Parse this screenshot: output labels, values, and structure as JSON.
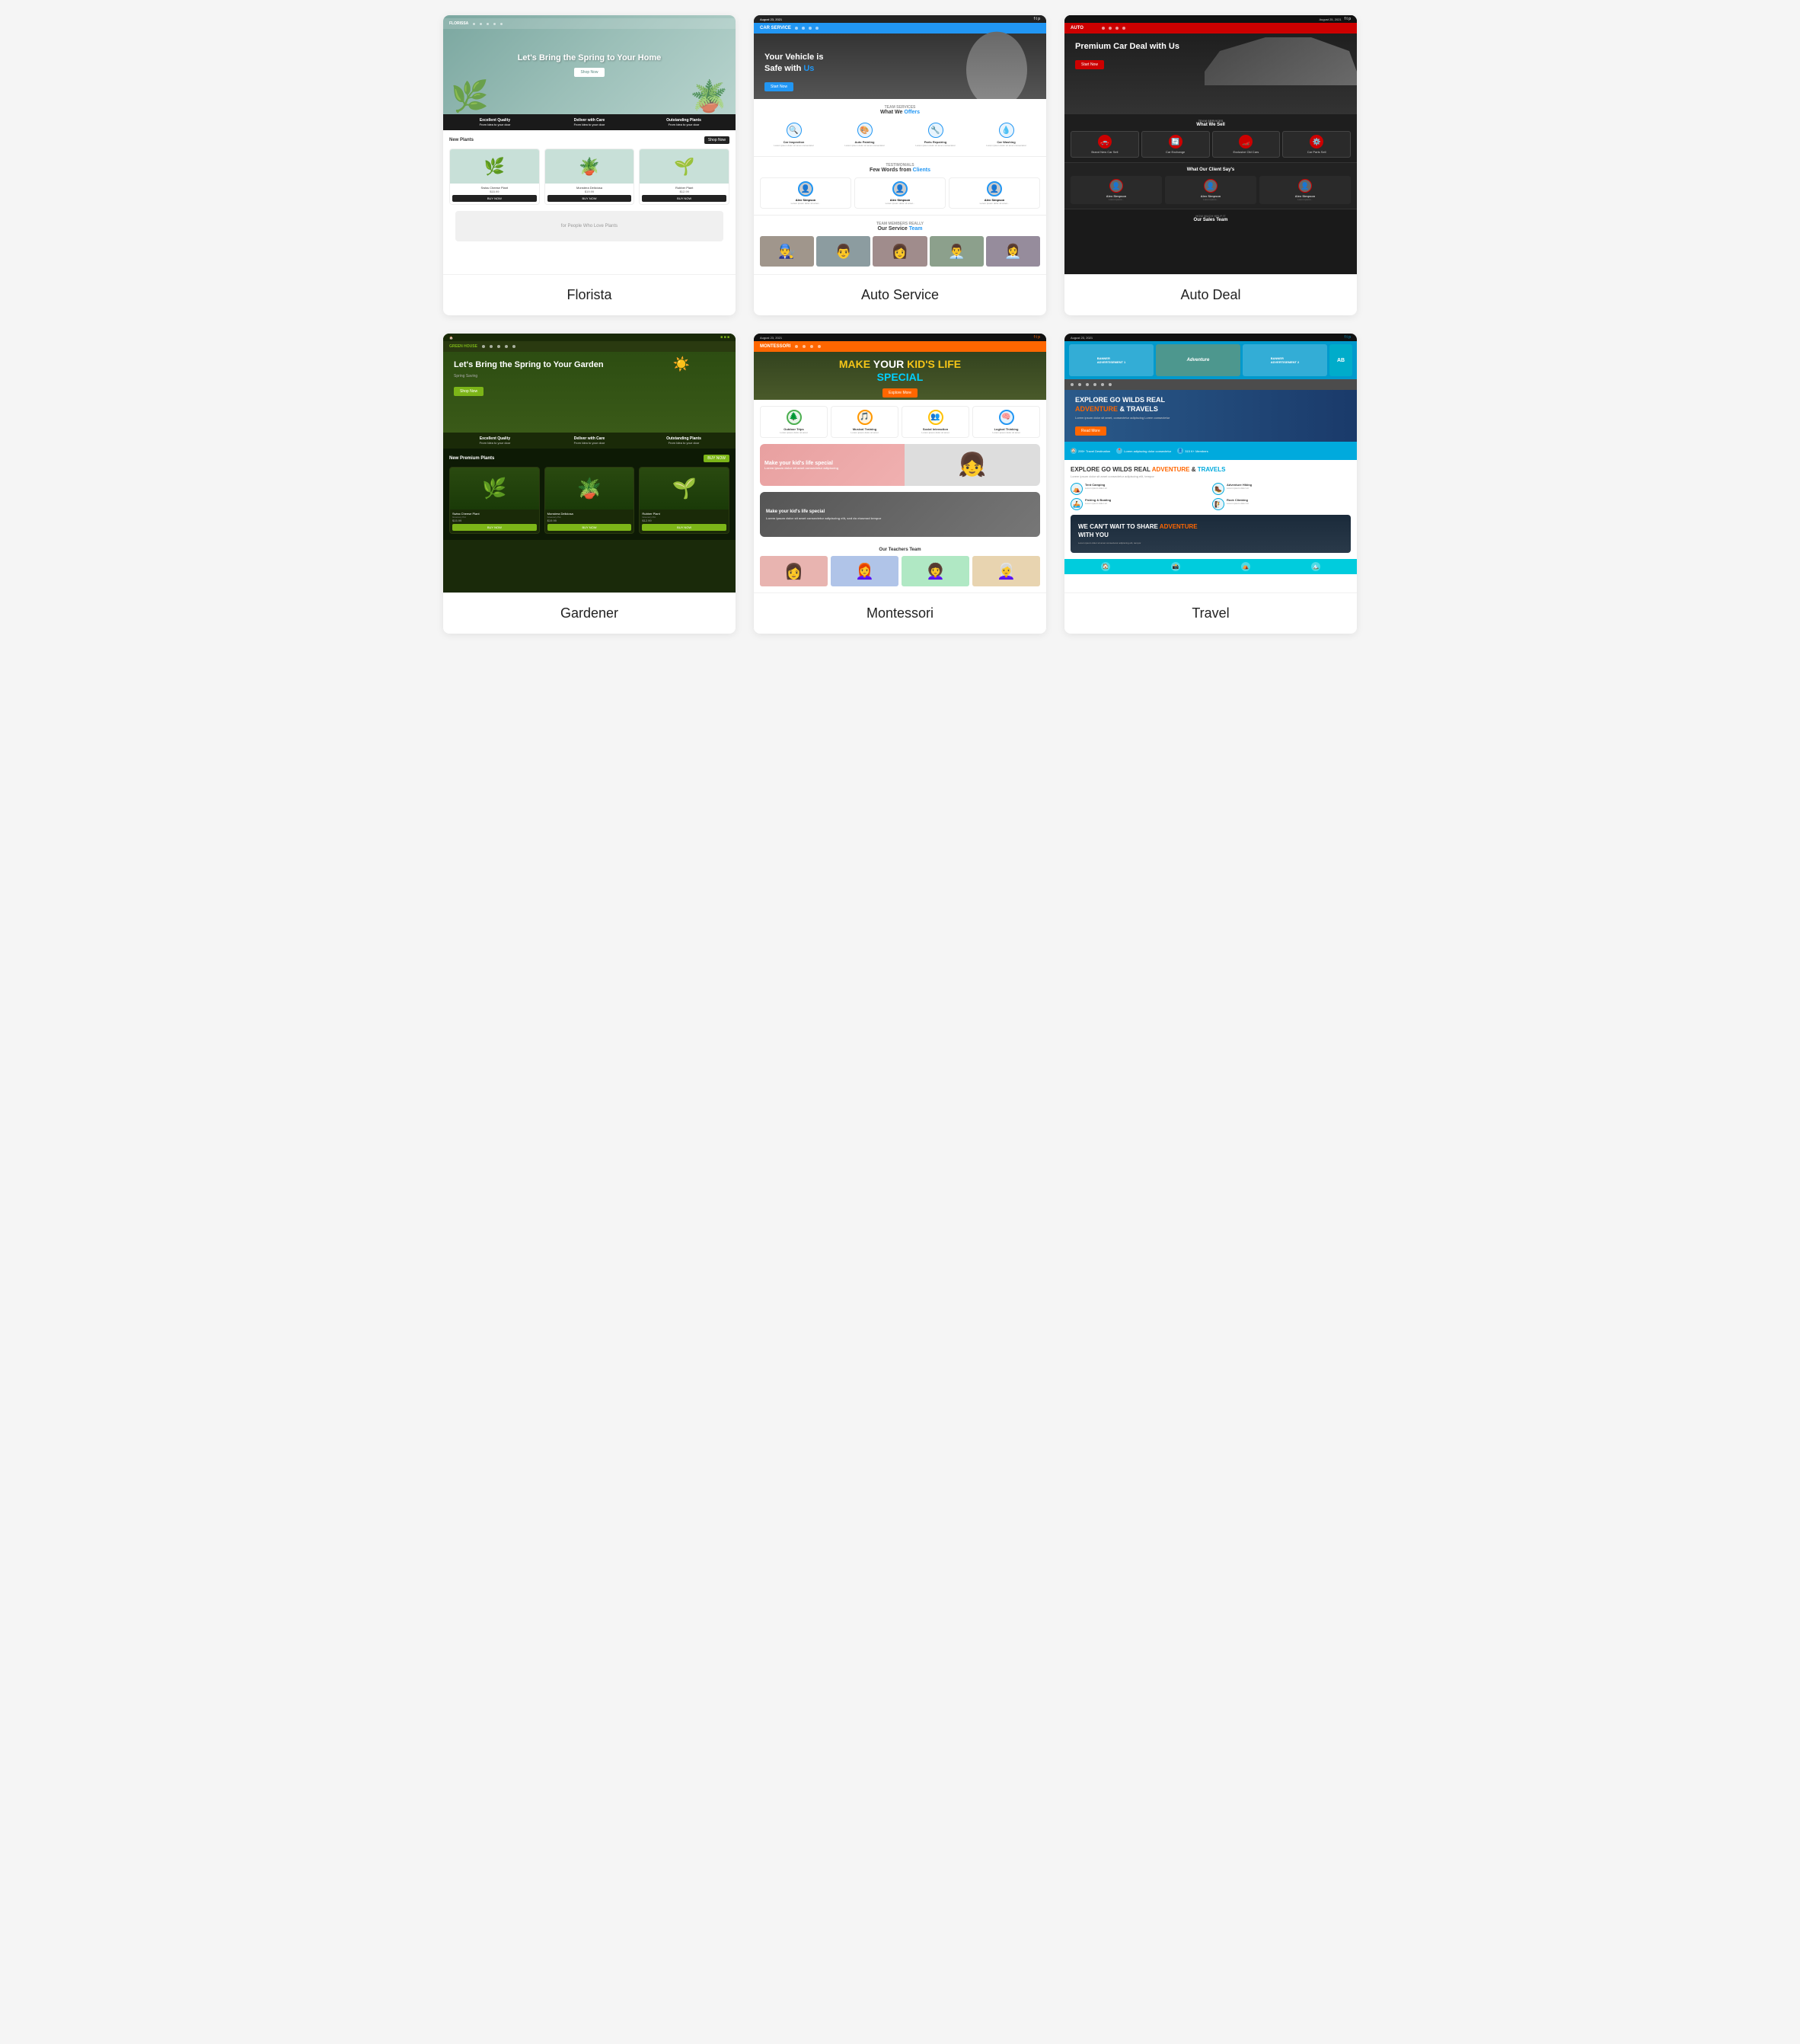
{
  "cards": [
    {
      "id": "florista",
      "label": "Florista",
      "hero": {
        "title": "Let's Bring the Spring to Your Home",
        "btn": "Shop Now"
      },
      "stats": [
        {
          "title": "Excellent Quality",
          "desc": "From Idea to your door"
        },
        {
          "title": "Deliver with Care",
          "desc": "From Idea to your door"
        },
        {
          "title": "Outstanding Plants",
          "desc": "From Idea to your door"
        }
      ],
      "products_header": {
        "label": "New Plants",
        "sub": "Shop Now"
      },
      "products": [
        {
          "name": "Swiss Cheese Plant",
          "cat": "Greenery Pot",
          "price": "$15.99",
          "btn": "BUY NOW",
          "emoji": "🌿"
        },
        {
          "name": "Monstera Deliciosa",
          "cat": "Greenery Pot",
          "price": "$19.99",
          "btn": "BUY NOW",
          "emoji": "🪴"
        },
        {
          "name": "Rubber Plant",
          "cat": "Greenery Pot",
          "price": "$12.99",
          "btn": "BUY NOW",
          "emoji": "🌱"
        }
      ]
    },
    {
      "id": "autoservice",
      "label": "Auto Service",
      "hero": {
        "date": "August 23, 2021",
        "title": "Your Vehicle is Safe with Us",
        "btn": "Start Now"
      },
      "what_we_offer": "What We Offers",
      "services": [
        {
          "name": "Car Inspection",
          "icon": "🔍"
        },
        {
          "name": "Auto Painting",
          "icon": "🎨"
        },
        {
          "name": "Parts Repairing",
          "icon": "🔧"
        },
        {
          "name": "Car Washing",
          "icon": "💧"
        }
      ],
      "testimonials_title": "Few Words from Clients",
      "testimonials": [
        {
          "name": "Alex Simpson",
          "text": "Lorem ipsum dolor sit amet...",
          "emoji": "👤"
        },
        {
          "name": "Alex Simpson",
          "text": "Lorem ipsum dolor sit amet...",
          "emoji": "👤"
        },
        {
          "name": "Alex Simpson",
          "text": "Lorem ipsum dolor sit amet...",
          "emoji": "👤"
        }
      ],
      "team_title": "Our Service Team",
      "team_colors": [
        "#888",
        "#777",
        "#666",
        "#555",
        "#444"
      ]
    },
    {
      "id": "autodeal",
      "label": "Auto Deal",
      "hero": {
        "title": "Premium Car Deal with Us",
        "btn": "Start Now"
      },
      "what_we_sell": "What We Sell",
      "services": [
        {
          "name": "Brand New Car Sell",
          "icon": "🚗"
        },
        {
          "name": "Car Exchange",
          "icon": "🔄"
        },
        {
          "name": "Exclusive Old Cars",
          "icon": "🏎️"
        },
        {
          "name": "Car Parts Sell",
          "icon": "⚙️"
        }
      ],
      "testimonials_title": "What Our Client Say's",
      "testimonials": [
        {
          "name": "Alex Simpson",
          "text": "Lorem ipsum...",
          "emoji": "👤"
        },
        {
          "name": "Alex Simpson",
          "text": "Lorem ipsum...",
          "emoji": "👤"
        },
        {
          "name": "Alex Simpson",
          "text": "Lorem ipsum...",
          "emoji": "👤"
        }
      ],
      "team_title": "Our Sales Team"
    },
    {
      "id": "gardener",
      "label": "Gardener",
      "hero": {
        "title": "Let's Bring the Spring to Your Garden",
        "sub": "Spring Saving",
        "btn": "Shop Now"
      },
      "stats": [
        {
          "title": "Excellent Quality",
          "desc": "From Idea to your door"
        },
        {
          "title": "Deliver with Care",
          "desc": "From Idea to your door"
        },
        {
          "title": "Outstanding Plants",
          "desc": "From Idea to your door"
        }
      ],
      "products_header": {
        "label": "New Premium Plants",
        "sub": "BUY NOW"
      },
      "products": [
        {
          "name": "Swiss Cheese Plant",
          "sub": "Greenery Pot",
          "price": "$15.99",
          "btn": "BUY NOW",
          "emoji": "🌿"
        },
        {
          "name": "Monstera Deliciosa",
          "sub": "Greenery Pot",
          "price": "$19.99",
          "btn": "BUY NOW",
          "emoji": "🪴"
        },
        {
          "name": "Rubber Plant",
          "sub": "Greenery Pot",
          "price": "$12.99",
          "btn": "BUY NOW",
          "emoji": "🌱"
        }
      ]
    },
    {
      "id": "montessori",
      "label": "Montessori",
      "hero": {
        "title_line1": "MAKE YOUR KID'S LIFE",
        "title_line2": "SPECIAL",
        "btn": "Explore More"
      },
      "features": [
        {
          "name": "Outdoor Trips",
          "icon": "🟢",
          "color": "#4CAF50"
        },
        {
          "name": "Musical Training",
          "icon": "🟠",
          "color": "#FF9800"
        },
        {
          "name": "Social Interaction",
          "icon": "🟡",
          "color": "#FFC107"
        },
        {
          "name": "Logical Thinking",
          "icon": "🔵",
          "color": "#2196F3"
        }
      ],
      "special_text": "Make your kid's life special",
      "special2_text": "Make your kid's life special",
      "teachers_title": "Our Teachers Team",
      "teachers": [
        "👩",
        "👩‍🦰",
        "👩‍🦱",
        "👩‍🦳"
      ]
    },
    {
      "id": "travel",
      "label": "Travel",
      "ads": [
        "BANNER ADVERTISEMENT 1",
        "Adventure",
        "BANNER ADVERTISEMENT 2",
        "AB"
      ],
      "hero": {
        "title_line1": "EXPLORE GO WILDS REAL",
        "title_line2": "ADVENTURE & TRAVELS",
        "orange": "ADVENTURE",
        "btn": "Read More"
      },
      "info_items": [
        {
          "icon": "🏠",
          "text": "295+ Travel Destination"
        },
        {
          "icon": "📍",
          "text": "Lorem adipiscing dolor consectetur"
        },
        {
          "icon": "👤",
          "text": "315 K+ Members"
        }
      ],
      "content_title": "EXPLORE GO WILDS REAL ADVENTURE & TRAVELS",
      "features": [
        {
          "icon": "⛺",
          "name": "Tent Camping",
          "desc": "Lorem ipsum dolor sit"
        },
        {
          "icon": "🥾",
          "name": "Adventure Hiking",
          "desc": "Lorem ipsum dolor sit"
        },
        {
          "icon": "🚣",
          "name": "Fishing & Boating",
          "desc": "Lorem ipsum dolor sit"
        },
        {
          "icon": "🧗",
          "name": "Rock Climbing",
          "desc": "Lorem ipsum dolor sit"
        }
      ],
      "adventure_text": "WE CAN'T WAIT TO SHARE ADVENTURE WITH YOU",
      "bottom_icons": [
        "🏠",
        "📸",
        "⛺",
        "🏔️"
      ]
    }
  ]
}
